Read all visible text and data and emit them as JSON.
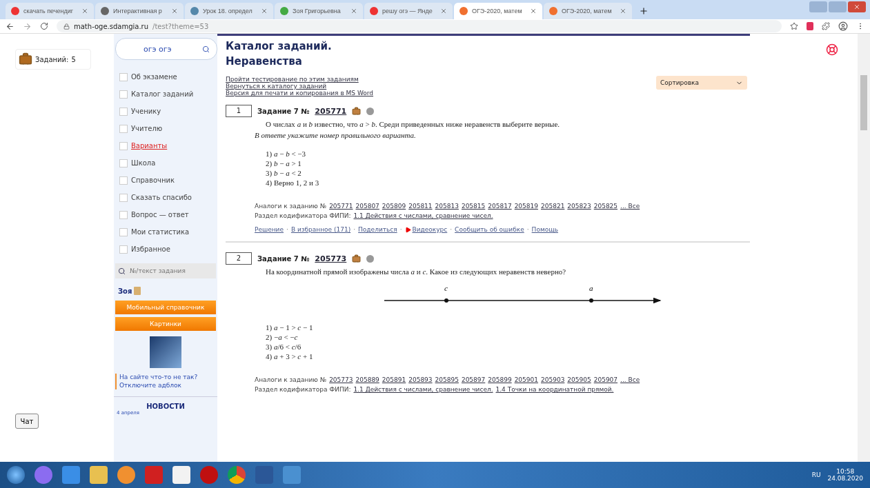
{
  "browser": {
    "tabs": [
      {
        "title": "скачать печендиг",
        "selected": false
      },
      {
        "title": "Интерактивная р",
        "selected": false
      },
      {
        "title": "Урок 18. определ",
        "selected": false
      },
      {
        "title": "Зоя Григорьевна",
        "selected": false
      },
      {
        "title": "решу огэ — Янде",
        "selected": false
      },
      {
        "title": "ОГЭ-2020, матем",
        "selected": true
      },
      {
        "title": "ОГЭ-2020, матем",
        "selected": false
      }
    ],
    "address": {
      "host": "math-oge.sdamgia.ru",
      "path": "/test?theme=53"
    }
  },
  "cart": {
    "label": "Заданий:",
    "count": "5"
  },
  "chat_button": "Чат",
  "sidebar": {
    "search": {
      "value": "огэ огэ"
    },
    "menu": [
      {
        "label": "Об экзамене",
        "highlighted": false
      },
      {
        "label": "Каталог заданий",
        "highlighted": false
      },
      {
        "label": "Ученику",
        "highlighted": false
      },
      {
        "label": "Учителю",
        "highlighted": false
      },
      {
        "label": "Варианты",
        "highlighted": true
      },
      {
        "label": "Школа",
        "highlighted": false
      },
      {
        "label": "Справочник",
        "highlighted": false
      },
      {
        "label": "Сказать спасибо",
        "highlighted": false
      },
      {
        "label": "Вопрос — ответ",
        "highlighted": false
      },
      {
        "label": "Мои статистика",
        "highlighted": false
      },
      {
        "label": "Избранное",
        "highlighted": false
      }
    ],
    "task_search": {
      "placeholder": "№/текст задания"
    },
    "user": "Зоя",
    "buttons": [
      "Мобильный справочник",
      "Картинки"
    ],
    "adblock": "На сайте что-то не так? Отключите адблок",
    "news": {
      "title": "НОВОСТИ",
      "date": "4 апреля"
    }
  },
  "main": {
    "title": "Каталог заданий.",
    "subtitle": "Неравенства",
    "links": [
      "Пройти тестирование по этим заданиям",
      "Вернуться к каталогу заданий",
      "Версия для печати и копирования в MS Word"
    ],
    "sort": "Сортировка",
    "problems": [
      {
        "number": "1",
        "heading": "Задание 7 №",
        "id": "205771",
        "statement": "О числах *a* и *b* известно, что *a* > *b*. Среди приведенных ниже неравенств выберите верные.",
        "note": "В ответе укажите номер правильного варианта.",
        "options": [
          "1) *a* − *b* < −3",
          "2) *b* − *a* > 1",
          "3) *b* − *a* < 2",
          "4) Верно 1, 2 и 3"
        ],
        "analogs_label": "Аналоги к заданию №",
        "analogs": [
          "205771",
          "205807",
          "205809",
          "205811",
          "205813",
          "205815",
          "205817",
          "205819",
          "205821",
          "205823",
          "205825"
        ],
        "analogs_more": "... Все",
        "codifier_label": "Раздел кодификатора ФИПИ:",
        "codifier": [
          "1.1 Действия с числами, сравнение чисел."
        ],
        "action_separator": "·",
        "actions": [
          {
            "label": "Решение",
            "video": false
          },
          {
            "label": "В избранное (171)",
            "video": false
          },
          {
            "label": "Поделиться",
            "video": false
          },
          {
            "label": "Видеокурс",
            "video": true
          },
          {
            "label": "Сообщить об ошибке",
            "video": false
          },
          {
            "label": "Помощь",
            "video": false
          }
        ]
      },
      {
        "number": "2",
        "heading": "Задание 7 №",
        "id": "205773",
        "statement": "На координатной прямой изображены числа *a* и *c*. Какое из следующих неравенств неверно?",
        "number_line": [
          "c",
          "a"
        ],
        "options": [
          "1) *a* − 1 > *c* − 1",
          "2) −*a* < −*c*",
          "3) *a*/6 < *c*/6",
          "4) *a* + 3 > *c* + 1"
        ],
        "analogs_label": "Аналоги к заданию №",
        "analogs": [
          "205773",
          "205889",
          "205891",
          "205893",
          "205895",
          "205897",
          "205899",
          "205901",
          "205903",
          "205905",
          "205907"
        ],
        "analogs_more": "... Все",
        "codifier_label": "Раздел кодификатора ФИПИ:",
        "codifier": [
          "1.1 Действия с числами, сравнение чисел.",
          "1.4 Точки на координатной прямой."
        ]
      }
    ]
  },
  "taskbar": {
    "lang": "RU",
    "time": "10:58",
    "date": "24.08.2020"
  }
}
